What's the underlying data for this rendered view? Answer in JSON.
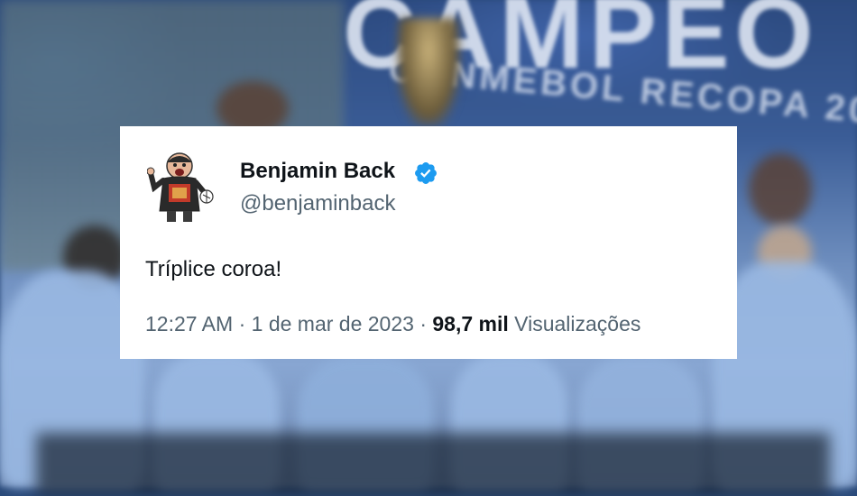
{
  "background": {
    "banner_text": "CAMPEO",
    "banner_subtext": "CONMEBOL RECOPA 20"
  },
  "tweet": {
    "author_name": "Benjamin Back",
    "author_handle": "@benjaminback",
    "verified": true,
    "verified_icon": "verified-badge-icon",
    "text": "Tríplice coroa!",
    "time": "12:27 AM",
    "separator": "·",
    "date": "1 de mar de 2023",
    "views_count": "98,7 mil",
    "views_label": "Visualizações"
  },
  "colors": {
    "verified_blue": "#1d9bf0",
    "text_primary": "#0f1419",
    "text_secondary": "#536471"
  }
}
